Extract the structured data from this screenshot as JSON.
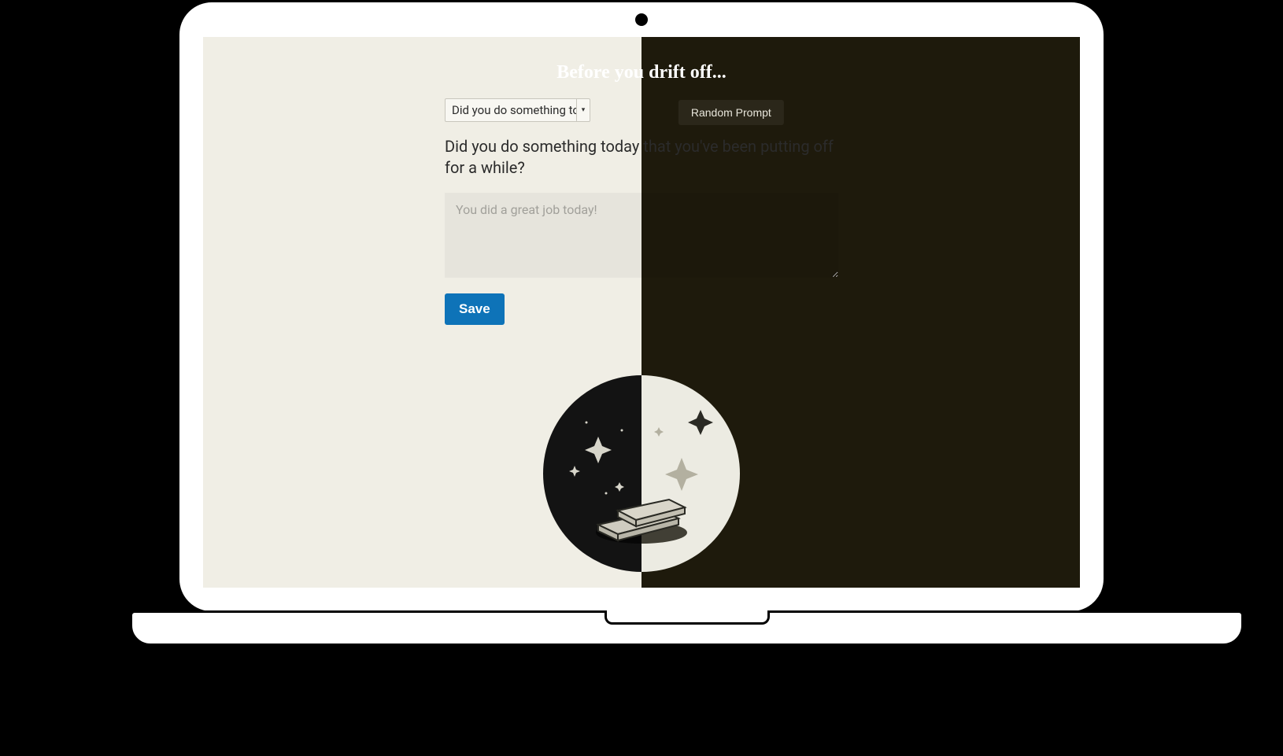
{
  "heading": "Before you drift off...",
  "random_prompt_label": "Random Prompt",
  "select": {
    "visible_text": "Did you do something to"
  },
  "prompt_question": "Did you do something today that you've been putting off for a while?",
  "answer": {
    "placeholder": "You did a great job today!",
    "value": ""
  },
  "save_label": "Save",
  "icons": {
    "dropdown_caret": "▾"
  }
}
